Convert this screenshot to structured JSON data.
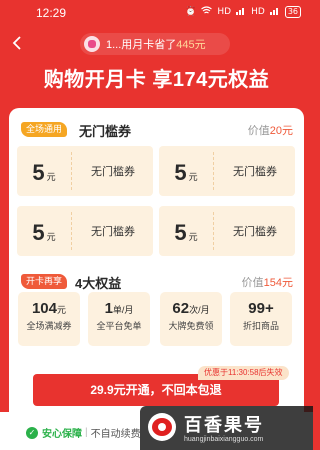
{
  "status_bar": {
    "time": "12:29",
    "icons": [
      "alarm-icon",
      "wifi-icon",
      "signal-icon",
      "signal-icon",
      "battery-icon"
    ],
    "network_a": "HD",
    "network_b": "HD",
    "battery": "36"
  },
  "header": {
    "savings_text": "1...用月卡省了",
    "savings_amount": "445元"
  },
  "hero": {
    "title": "购物开月卡 享174元权益"
  },
  "coupon_section": {
    "tag": "全场通用",
    "title": "无门槛券",
    "value_prefix": "价值",
    "value_amount": "20元",
    "coupons": [
      {
        "amount": "5",
        "unit": "元",
        "name": "无门槛券"
      },
      {
        "amount": "5",
        "unit": "元",
        "name": "无门槛券"
      },
      {
        "amount": "5",
        "unit": "元",
        "name": "无门槛券"
      },
      {
        "amount": "5",
        "unit": "元",
        "name": "无门槛券"
      }
    ]
  },
  "perk_section": {
    "tag": "开卡再享",
    "title": "4大权益",
    "value_prefix": "价值",
    "value_amount": "154元",
    "perks": [
      {
        "value": "104",
        "suffix": "元",
        "label": "全场满减券"
      },
      {
        "value": "1",
        "suffix": "单/月",
        "label": "全平台免单"
      },
      {
        "value": "62",
        "suffix": "次/月",
        "label": "大牌免费领"
      },
      {
        "value": "99+",
        "suffix": "",
        "label": "折扣商品"
      }
    ]
  },
  "promo": {
    "timer_text": "优惠于11:30:58后失效"
  },
  "cta": {
    "label": "29.9元开通，不回本包退"
  },
  "footer": {
    "guarantee_label": "安心保障",
    "separator": "|",
    "note": "不自动续费"
  },
  "watermark": {
    "title": "百香果号",
    "url": "huangjinbaixiangguo.com"
  },
  "colors": {
    "brand_red": "#e8332f",
    "coupon_bg": "#fdf1df",
    "accent_orange": "#f5a623",
    "guarantee_green": "#2bb14a"
  }
}
